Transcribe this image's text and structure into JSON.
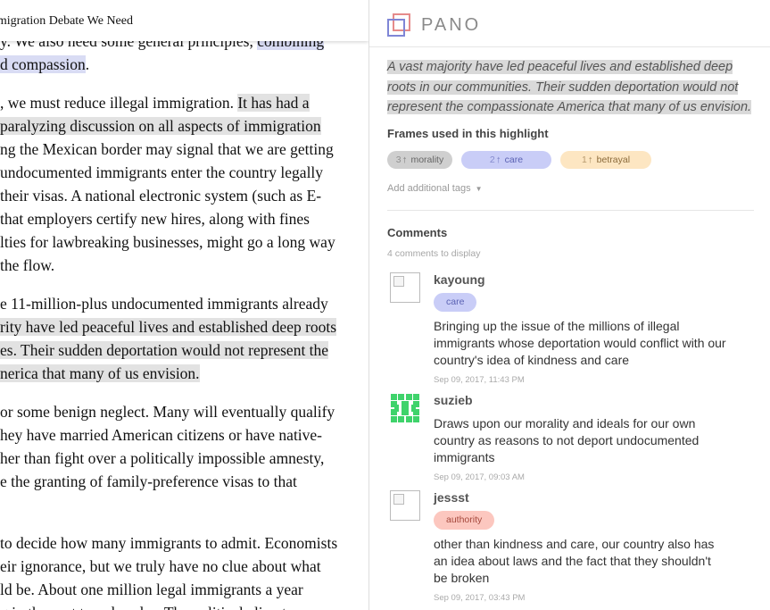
{
  "article": {
    "header_title": "The Immigration Debate We Need",
    "lines": [
      {
        "segments": [
          {
            "text": "y. We also need some general principles, ",
            "hl": ""
          },
          {
            "text": "combining",
            "hl": "blue"
          }
        ]
      },
      {
        "segments": [
          {
            "text": "d compassion",
            "hl": "blue"
          },
          {
            "text": ".",
            "hl": ""
          }
        ]
      },
      {
        "segments": [
          {
            "text": ", we must reduce illegal immigration. ",
            "hl": ""
          },
          {
            "text": "It has had a",
            "hl": "gray"
          }
        ]
      },
      {
        "segments": [
          {
            "text": "paralyzing discussion on all aspects of immigration",
            "hl": "gray"
          }
        ]
      },
      {
        "segments": [
          {
            "text": "ng the Mexican border may signal that we are getting",
            "hl": ""
          }
        ]
      },
      {
        "segments": [
          {
            "text": " undocumented immigrants enter the country legally",
            "hl": ""
          }
        ]
      },
      {
        "segments": [
          {
            "text": " their visas. A national electronic system (such as E-",
            "hl": ""
          }
        ]
      },
      {
        "segments": [
          {
            "text": " that employers certify new hires, along with fines",
            "hl": ""
          }
        ]
      },
      {
        "segments": [
          {
            "text": "lties for lawbreaking businesses, might go a long way",
            "hl": ""
          }
        ]
      },
      {
        "segments": [
          {
            "text": " the flow.",
            "hl": ""
          }
        ]
      },
      {
        "segments": [
          {
            "text": "e 11-million-plus undocumented immigrants already",
            "hl": ""
          }
        ]
      },
      {
        "segments": [
          {
            "text": "rity have led peaceful lives and established deep roots",
            "hl": "gray"
          }
        ]
      },
      {
        "segments": [
          {
            "text": "es. Their sudden deportation would not represent the",
            "hl": "gray"
          }
        ]
      },
      {
        "segments": [
          {
            "text": "nerica that many of us envision.",
            "hl": "gray"
          }
        ]
      },
      {
        "segments": [
          {
            "text": "or some benign neglect. Many will eventually qualify",
            "hl": ""
          }
        ]
      },
      {
        "segments": [
          {
            "text": "hey have married American citizens or have native-",
            "hl": ""
          }
        ]
      },
      {
        "segments": [
          {
            "text": "her than fight over a politically impossible amnesty,",
            "hl": ""
          }
        ]
      },
      {
        "segments": [
          {
            "text": "e the granting of family-preference visas to that",
            "hl": ""
          }
        ]
      },
      {
        "segments": [
          {
            "text": "to decide how many immigrants to admit. Economists",
            "hl": ""
          }
        ]
      },
      {
        "segments": [
          {
            "text": "eir ignorance, but we truly have no clue about what",
            "hl": ""
          }
        ]
      },
      {
        "segments": [
          {
            "text": "ld be. About one million legal immigrants a year",
            "hl": ""
          }
        ]
      },
      {
        "segments": [
          {
            "text": "g in the past two decades. The political climate",
            "hl": ""
          }
        ]
      }
    ]
  },
  "sidebar": {
    "logo_text": "PANO",
    "highlight_quote": "A vast majority have led peaceful lives and established deep roots in our communities. Their sudden deportation would not represent the compassionate America that many of us envision.",
    "frames_title": "Frames used in this highlight",
    "frames": [
      {
        "count": "3",
        "label": "morality",
        "bg": "#cfcfcf",
        "fg": "#666666"
      },
      {
        "count": "2",
        "label": "care",
        "bg": "#c9cdf7",
        "fg": "#5b62b3"
      },
      {
        "count": "1",
        "label": "betrayal",
        "bg": "#fde6c2",
        "fg": "#8a6a3a"
      }
    ],
    "add_tags_label": "Add additional tags",
    "comments_title": "Comments",
    "comments_count": "4 comments to display",
    "comments": [
      {
        "user": "kayoung",
        "tag": "care",
        "tag_bg": "#c9cdf7",
        "tag_fg": "#5b62b3",
        "avatar": "broken",
        "text": "Bringing up the issue of the millions of illegal immigrants whose deportation would conflict with our country's idea of kindness and care",
        "time": "Sep 09, 2017, 11:43 PM"
      },
      {
        "user": "suzieb",
        "tag": "",
        "avatar": "identicon",
        "text": "Draws upon our morality and ideals for our own country as reasons to not deport undocumented immigrants",
        "time": "Sep 09, 2017, 09:03 AM"
      },
      {
        "user": "jessst",
        "tag": "authority",
        "tag_bg": "#fcc7bf",
        "tag_fg": "#a5483c",
        "avatar": "broken",
        "text": "other than kindness and care, our country also has an idea about laws and the fact that they shouldn't be broken",
        "time": "Sep 09, 2017, 03:43 PM"
      }
    ]
  },
  "colors": {
    "identicon_green": "#3fd36b",
    "logo_blue": "#7f86d6",
    "logo_red": "#e58b8b"
  }
}
